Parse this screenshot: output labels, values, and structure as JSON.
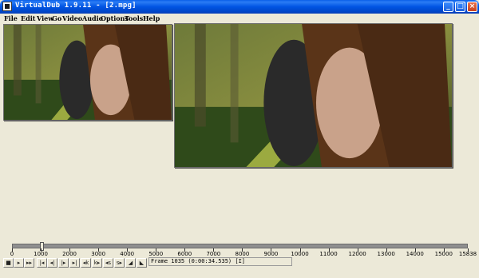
{
  "window": {
    "title": "VirtualDub 1.9.11 - [2.mpg]",
    "controls": {
      "minimize": "_",
      "maximize": "□",
      "close": "×"
    }
  },
  "menu": [
    "File",
    "Edit",
    "View",
    "Go",
    "Video",
    "Audio",
    "Options",
    "Tools",
    "Help"
  ],
  "timeline": {
    "ticks": [
      "0",
      "1000",
      "2000",
      "3000",
      "4000",
      "5000",
      "6000",
      "7000",
      "8000",
      "9000",
      "10000",
      "11000",
      "12000",
      "13000",
      "14000",
      "15000",
      "15838"
    ],
    "position_fraction": 0.065
  },
  "toolbar": {
    "buttons": [
      {
        "name": "stop-icon",
        "glyph": "■"
      },
      {
        "name": "play-input-icon",
        "glyph": "▸"
      },
      {
        "name": "play-output-icon",
        "glyph": "▸▸"
      },
      {
        "name": "go-start-icon",
        "glyph": "|◂"
      },
      {
        "name": "prev-frame-icon",
        "glyph": "◂|"
      },
      {
        "name": "next-frame-icon",
        "glyph": "|▸"
      },
      {
        "name": "go-end-icon",
        "glyph": "▸|"
      },
      {
        "name": "prev-keyframe-icon",
        "glyph": "◂k"
      },
      {
        "name": "next-keyframe-icon",
        "glyph": "k▸"
      },
      {
        "name": "scene-back-icon",
        "glyph": "◂s"
      },
      {
        "name": "scene-forward-icon",
        "glyph": "s▸"
      },
      {
        "name": "mark-in-icon",
        "glyph": "◢"
      },
      {
        "name": "mark-out-icon",
        "glyph": "◣"
      }
    ],
    "frame_status": "Frame 1035 (0:00:34.535) [I]"
  },
  "colors": {
    "titlebar": "#0054e3",
    "chrome": "#ece9d8"
  }
}
